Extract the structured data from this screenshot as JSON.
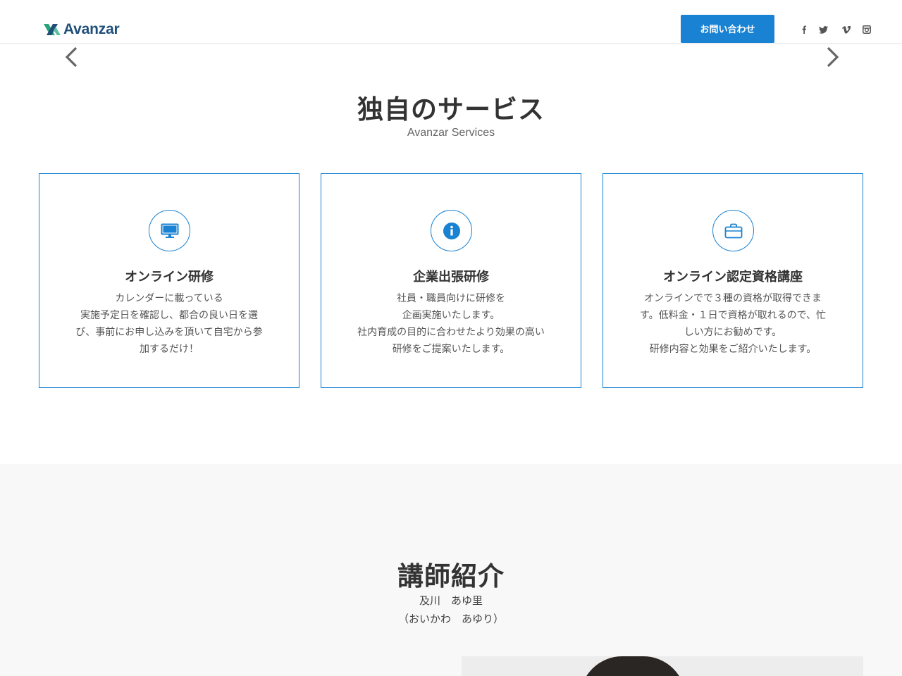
{
  "header": {
    "logo_text": "Avanzar",
    "contact_label": "お問い合わせ",
    "social_icons": [
      "facebook-icon",
      "twitter-icon",
      "vimeo-icon",
      "instagram-icon"
    ]
  },
  "slider": {
    "prev_icon": "chevron-left-icon",
    "next_icon": "chevron-right-icon"
  },
  "services": {
    "title": "独自のサービス",
    "subtitle": "Avanzar Services",
    "cards": [
      {
        "icon": "monitor-icon",
        "title": "オンライン研修",
        "lines": [
          "カレンダーに載っている",
          "実施予定日を確認し、都合の良い日を選",
          "び、事前にお申し込みを頂いて自宅から参",
          "加するだけ！"
        ]
      },
      {
        "icon": "info-icon",
        "title": "企業出張研修",
        "lines": [
          "社員・職員向けに研修を",
          "企画実施いたします。",
          "社内育成の目的に合わせたより効果の高い",
          "研修をご提案いたします。"
        ]
      },
      {
        "icon": "briefcase-icon",
        "title": "オンライン認定資格講座",
        "lines": [
          "オンラインでで３種の資格が取得できま",
          "す。低料金・１日で資格が取れるので、忙",
          "しい方にお勧めです。",
          "研修内容と効果をご紹介いたします。"
        ]
      }
    ]
  },
  "instructor": {
    "title": "講師紹介",
    "name": "及川　あゆ里",
    "reading": "（おいかわ　あゆり）"
  },
  "colors": {
    "accent": "#1a82d2",
    "logo": "#1f4f7a",
    "section_bg": "#f8f8f8"
  }
}
